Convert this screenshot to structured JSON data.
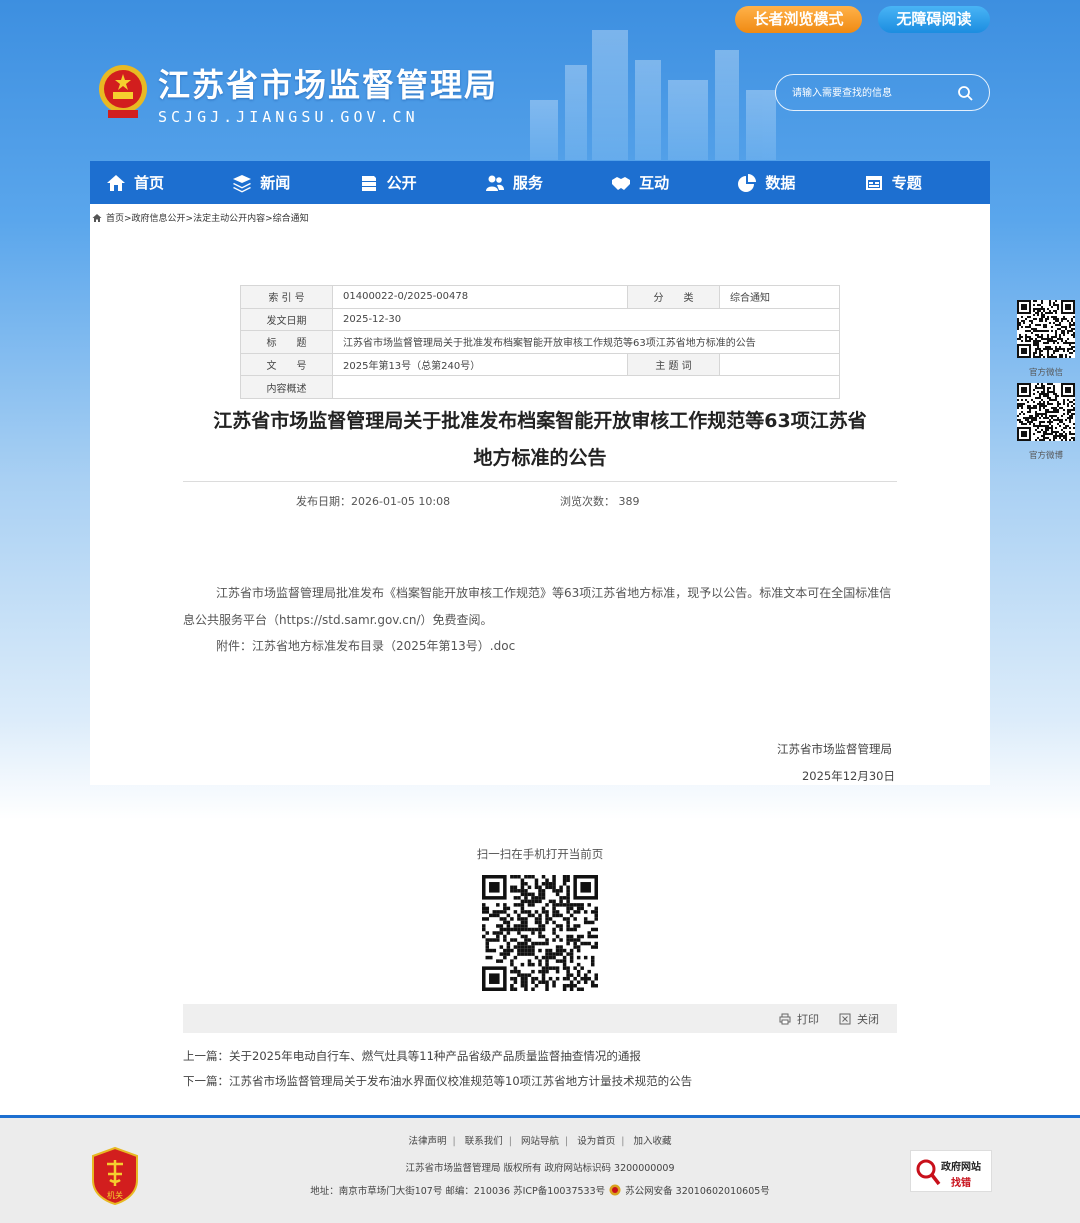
{
  "header": {
    "title": "江苏省市场监督管理局",
    "domain": "SCJGJ.JIANGSU.GOV.CN",
    "elder_mode": "长者浏览模式",
    "accessible_mode": "无障碍阅读",
    "search_placeholder": "请输入需要查找的信息"
  },
  "nav": {
    "items": [
      {
        "label": "首页",
        "icon": "home-icon"
      },
      {
        "label": "新闻",
        "icon": "layers-icon"
      },
      {
        "label": "公开",
        "icon": "stack-icon"
      },
      {
        "label": "服务",
        "icon": "people-icon"
      },
      {
        "label": "互动",
        "icon": "handshake-icon"
      },
      {
        "label": "数据",
        "icon": "pie-chart-icon"
      },
      {
        "label": "专题",
        "icon": "monitor-icon"
      }
    ]
  },
  "breadcrumb": "首页>政府信息公开>法定主动公开内容>综合通知",
  "meta": {
    "index_label": "索 引 号",
    "index_value": "01400022-0/2025-00478",
    "category_label": "分　　类",
    "category_value": "综合通知",
    "date_label": "发文日期",
    "date_value": "2025-12-30",
    "title_label": "标　　题",
    "title_value": "江苏省市场监督管理局关于批准发布档案智能开放审核工作规范等63项江苏省地方标准的公告",
    "docno_label": "文　　号",
    "docno_value": "2025年第13号（总第240号）",
    "keyword_label": "主 题 词",
    "keyword_value": "",
    "summary_label": "内容概述",
    "summary_value": ""
  },
  "article": {
    "title_line1": "江苏省市场监督管理局关于批准发布档案智能开放审核工作规范等63项江苏省",
    "title_line2": "地方标准的公告",
    "publish_date": "发布日期：2026-01-05 10:08",
    "views": "浏览次数： 389",
    "paragraph1": "江苏省市场监督管理局批准发布《档案智能开放审核工作规范》等63项江苏省地方标准，现予以公告。标准文本可在全国标准信息公共服务平台（https://std.samr.gov.cn/）免费查阅。",
    "attachment": "附件：江苏省地方标准发布目录（2025年第13号）.doc",
    "sign_org": "江苏省市场监督管理局",
    "sign_date": "2025年12月30日"
  },
  "side": {
    "wechat_label": "官方微信",
    "weibo_label": "官方微博"
  },
  "bottom": {
    "scan_label": "扫一扫在手机打开当前页",
    "print_label": "打印",
    "close_label": "关闭",
    "prev": "上一篇：关于2025年电动自行车、燃气灶具等11种产品省级产品质量监督抽查情况的通报",
    "next": "下一篇：江苏省市场监督管理局关于发布油水界面仪校准规范等10项江苏省地方计量技术规范的公告"
  },
  "footer": {
    "links": [
      "法律声明",
      "联系我们",
      "网站导航",
      "设为首页",
      "加入收藏"
    ],
    "copyright": "江苏省市场监督管理局 版权所有 政府网站标识码 3200000009",
    "address": "地址：南京市草场门大街107号 邮编：210036 苏ICP备10037533号",
    "police": "苏公网安备 32010602010605号",
    "party_badge": "机关",
    "gov_badge_line1": "政府网站",
    "gov_badge_line2": "找错"
  },
  "colors": {
    "nav_blue": "#1d6fd0",
    "elder_orange": "#f08a12",
    "access_blue": "#1c8de0"
  }
}
